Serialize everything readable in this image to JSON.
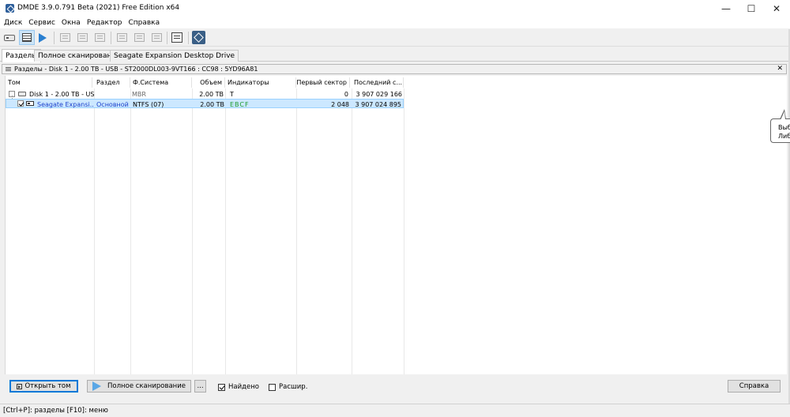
{
  "window": {
    "title": "DMDE 3.9.0.791 Beta (2021) Free Edition x64",
    "min_glyph": "—",
    "max_glyph": "☐",
    "close_glyph": "✕"
  },
  "menu": [
    "Диск",
    "Сервис",
    "Окна",
    "Редактор",
    "Справка"
  ],
  "tabs": [
    "Разделы",
    "Полное сканирование",
    "Seagate Expansion Desktop Drive"
  ],
  "panel": {
    "title": "Разделы - Disk 1 - 2.00 TB - USB - ST2000DL003-9VT166 : CC98 : 5YD96A81",
    "close_glyph": "✕"
  },
  "columns": [
    "Том",
    "Раздел",
    "Ф.Система",
    "Объем",
    "Индикаторы",
    "Первый сектор",
    "Последний с..."
  ],
  "rows": [
    {
      "volume": "Disk 1 - 2.00 TB - US...",
      "partition": "",
      "fs": "MBR",
      "size": "2.00 TB",
      "indicators": "T",
      "first_sector": "0",
      "last_sector": "3 907 029 166"
    },
    {
      "volume": "Seagate Expansi...",
      "partition": "Основной",
      "fs": "NTFS (07)",
      "size": "2.00 TB",
      "indicators": "EBCF",
      "first_sector": "2 048",
      "last_sector": "3 907 024 895"
    }
  ],
  "buttons": {
    "open_volume": "Открыть том",
    "full_scan": "Полное сканирование",
    "more": "...",
    "help": "Справка"
  },
  "checks": {
    "found": "Найдено",
    "extended": "Расшир."
  },
  "status": "[Ctrl+P]: разделы  [F10]: меню",
  "balloon": [
    "Выб",
    "Либ"
  ]
}
